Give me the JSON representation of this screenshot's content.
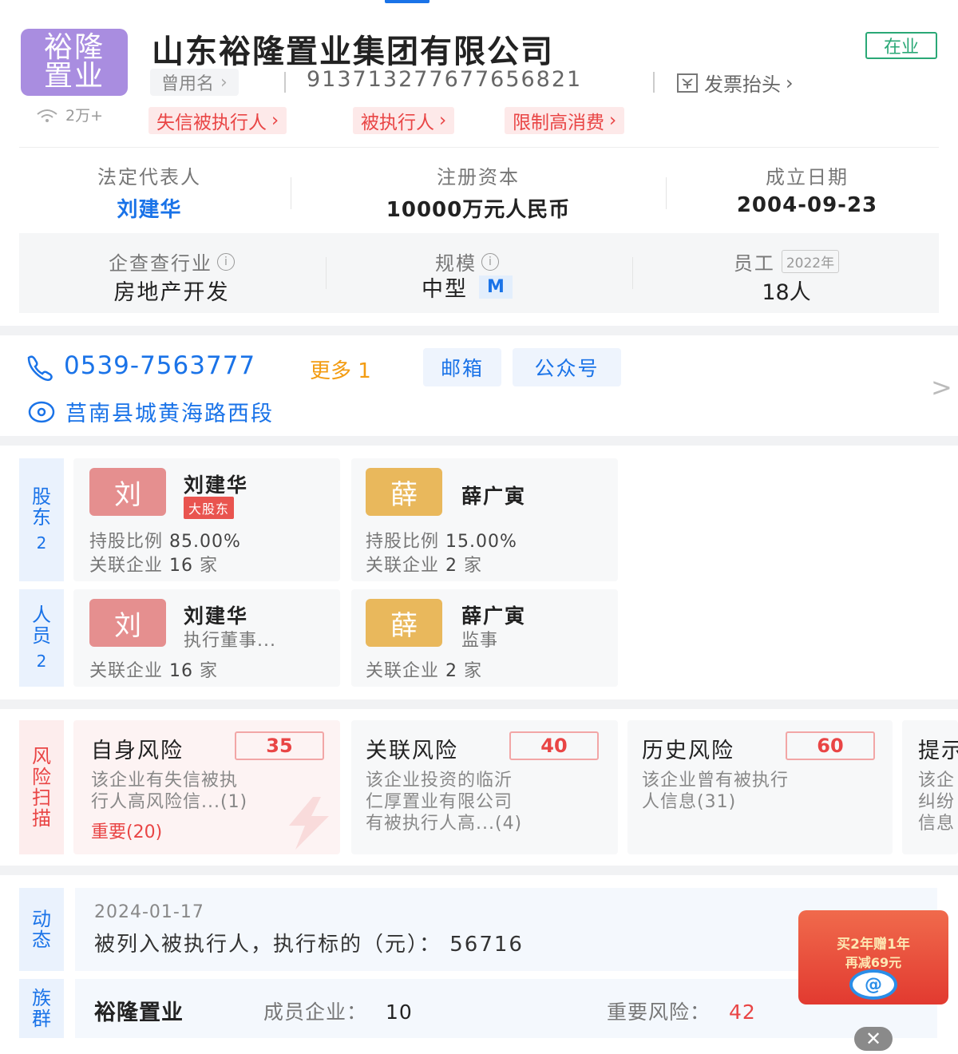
{
  "header": {
    "logo_line1": "裕隆",
    "logo_line2": "置业",
    "follow_count": "2万+",
    "company_name": "山东裕隆置业集团有限公司",
    "status": "在业",
    "former_names_label": "曾用名",
    "credit_code": "913713277677656821",
    "invoice_label": "发票抬头",
    "risk_tags": [
      "失信被执行人",
      "被执行人",
      "限制高消费"
    ]
  },
  "info": {
    "legal_rep_label": "法定代表人",
    "legal_rep_value": "刘建华",
    "capital_label": "注册资本",
    "capital_value": "10000万元人民币",
    "founded_label": "成立日期",
    "founded_value": "2004-09-23",
    "industry_label": "企查查行业",
    "industry_value": "房地产开发",
    "scale_label": "规模",
    "scale_value": "中型",
    "scale_badge": "M",
    "staff_label": "员工",
    "staff_year": "2022年",
    "staff_value": "18人"
  },
  "contact": {
    "phone": "0539-7563777",
    "more_label": "更多 1",
    "email_label": "邮箱",
    "wechat_label": "公众号",
    "address": "莒南县城黄海路西段",
    "chevron": ">"
  },
  "shareholders": {
    "side_label": [
      "股",
      "东"
    ],
    "count": "2",
    "items": [
      {
        "avatar": "刘",
        "name": "刘建华",
        "tag": "大股东",
        "ratio_label": "持股比例",
        "ratio": "85.00%",
        "related_label": "关联企业",
        "related": "16",
        "unit": "家"
      },
      {
        "avatar": "薛",
        "name": "薛广寅",
        "ratio_label": "持股比例",
        "ratio": "15.00%",
        "related_label": "关联企业",
        "related": "2",
        "unit": "家"
      }
    ]
  },
  "personnel": {
    "side_label": [
      "人",
      "员"
    ],
    "count": "2",
    "items": [
      {
        "avatar": "刘",
        "name": "刘建华",
        "role": "执行董事...",
        "related_label": "关联企业",
        "related": "16",
        "unit": "家"
      },
      {
        "avatar": "薛",
        "name": "薛广寅",
        "role": "监事",
        "related_label": "关联企业",
        "related": "2",
        "unit": "家"
      }
    ]
  },
  "risk": {
    "side_label": [
      "风",
      "险",
      "扫",
      "描"
    ],
    "items": [
      {
        "title": "自身风险",
        "score": "35",
        "desc1": "该企业有失信被执",
        "desc2": "行人高风险信...(1)",
        "important": "重要(20)"
      },
      {
        "title": "关联风险",
        "score": "40",
        "desc1": "该企业投资的临沂",
        "desc2": "仁厚置业有限公司",
        "desc3": "有被执行人高...(4)"
      },
      {
        "title": "历史风险",
        "score": "60",
        "desc1": "该企业曾有被执行",
        "desc2": "人信息(31)"
      },
      {
        "title": "提示",
        "desc1": "该企",
        "desc2": "纠纷",
        "desc3": "信息"
      }
    ]
  },
  "news": {
    "side_label": [
      "动",
      "态"
    ],
    "date": "2024-01-17",
    "text": "被列入被执行人，执行标的（元）： 56716"
  },
  "group": {
    "side_label": [
      "族",
      "群"
    ],
    "name": "裕隆置业",
    "members_label": "成员企业：",
    "members": "10",
    "risk_label": "重要风险：",
    "risk_value": "42"
  },
  "promo": {
    "line1": "买2年赠1年",
    "line2": "再减69元",
    "close": "✕"
  },
  "colors": {
    "accent": "#1a73e8",
    "danger": "#e94545",
    "status": "#2aa876",
    "logo": "#a98de0"
  }
}
